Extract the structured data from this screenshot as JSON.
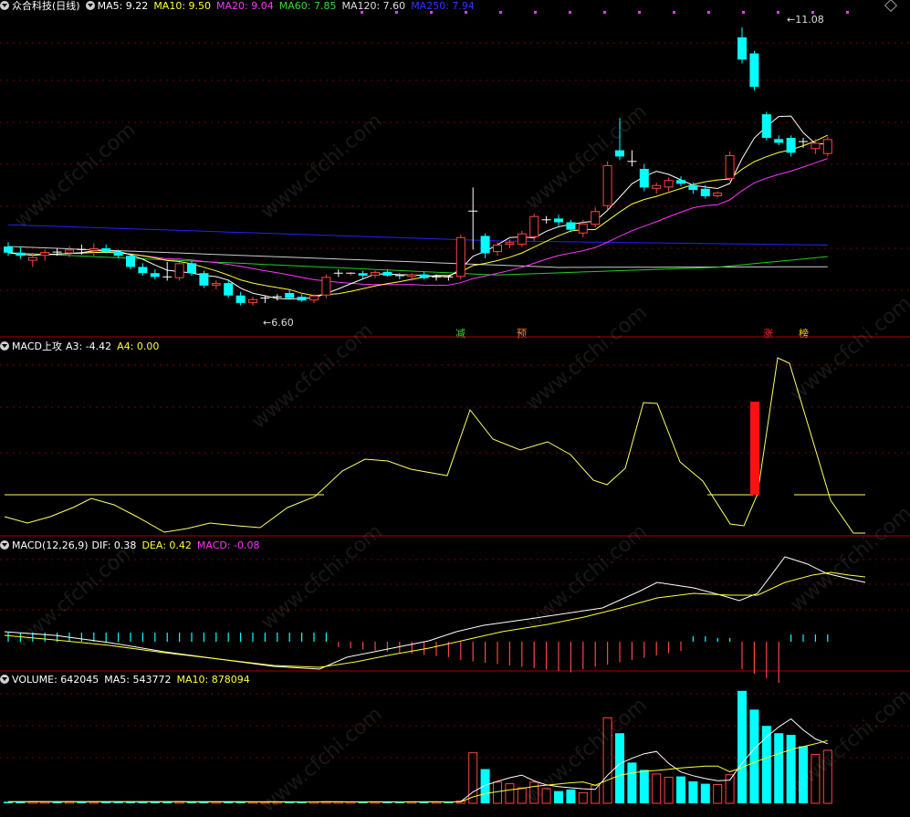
{
  "stock": {
    "title": "众合科技(日线)"
  },
  "panels": {
    "price": {
      "ma": [
        {
          "label": "MA5: 9.22",
          "color": "#ffffff"
        },
        {
          "label": "MA10: 9.50",
          "color": "#ffff33"
        },
        {
          "label": "MA20: 9.04",
          "color": "#ff33ff"
        },
        {
          "label": "MA60: 7.85",
          "color": "#33dd33"
        },
        {
          "label": "MA120: 7.60",
          "color": "#dddddd"
        },
        {
          "label": "MA250: 7.94",
          "color": "#3333ff"
        }
      ],
      "high_label": "11.08",
      "low_label": "6.60",
      "signal_tags": [
        {
          "text": "减",
          "color": "#33dd33"
        },
        {
          "text": "预",
          "color": "#ff8833"
        },
        {
          "text": "涨",
          "color": "#ff3333"
        },
        {
          "text": "榜",
          "color": "#ffcc00"
        }
      ]
    },
    "macd_attack": {
      "name": "MACD上攻",
      "a3": "A3: -4.42",
      "a4": "A4: 0.00"
    },
    "macd": {
      "name": "MACD(12,26,9)",
      "dif": "DIF: 0.38",
      "dea": "DEA: 0.42",
      "macd": "MACD: -0.08"
    },
    "volume": {
      "name": "VOLUME: 642045",
      "ma5": "MA5: 543772",
      "ma10": "MA10: 878094"
    }
  },
  "watermark": "www.cfchi.com",
  "colors": {
    "up": "#ff4444",
    "down": "#00ffff",
    "grid": "#7a0000",
    "bg": "#000000"
  },
  "chart_data": {
    "type": "candlestick",
    "price_axis_range": [
      6.3,
      11.3
    ],
    "candles": [
      {
        "o": 7.55,
        "h": 7.62,
        "l": 7.4,
        "c": 7.45
      },
      {
        "o": 7.45,
        "h": 7.55,
        "l": 7.35,
        "c": 7.4
      },
      {
        "o": 7.32,
        "h": 7.45,
        "l": 7.22,
        "c": 7.38
      },
      {
        "o": 7.4,
        "h": 7.5,
        "l": 7.32,
        "c": 7.46
      },
      {
        "o": 7.46,
        "h": 7.52,
        "l": 7.4,
        "c": 7.44
      },
      {
        "o": 7.44,
        "h": 7.56,
        "l": 7.38,
        "c": 7.5
      },
      {
        "o": 7.5,
        "h": 7.58,
        "l": 7.42,
        "c": 7.48
      },
      {
        "o": 7.48,
        "h": 7.6,
        "l": 7.4,
        "c": 7.52
      },
      {
        "o": 7.52,
        "h": 7.58,
        "l": 7.44,
        "c": 7.46
      },
      {
        "o": 7.46,
        "h": 7.5,
        "l": 7.36,
        "c": 7.4
      },
      {
        "o": 7.4,
        "h": 7.42,
        "l": 7.18,
        "c": 7.22
      },
      {
        "o": 7.22,
        "h": 7.28,
        "l": 7.08,
        "c": 7.12
      },
      {
        "o": 7.12,
        "h": 7.18,
        "l": 7.02,
        "c": 7.06
      },
      {
        "o": 7.06,
        "h": 7.3,
        "l": 7.0,
        "c": 7.04
      },
      {
        "o": 7.04,
        "h": 7.3,
        "l": 7.0,
        "c": 7.28
      },
      {
        "o": 7.28,
        "h": 7.32,
        "l": 7.08,
        "c": 7.12
      },
      {
        "o": 7.12,
        "h": 7.16,
        "l": 6.88,
        "c": 6.92
      },
      {
        "o": 6.92,
        "h": 7.0,
        "l": 6.86,
        "c": 6.96
      },
      {
        "o": 6.96,
        "h": 7.02,
        "l": 6.72,
        "c": 6.76
      },
      {
        "o": 6.76,
        "h": 6.82,
        "l": 6.6,
        "c": 6.64
      },
      {
        "o": 6.64,
        "h": 6.74,
        "l": 6.6,
        "c": 6.7
      },
      {
        "o": 6.7,
        "h": 6.76,
        "l": 6.64,
        "c": 6.72
      },
      {
        "o": 6.74,
        "h": 6.78,
        "l": 6.68,
        "c": 6.74
      },
      {
        "o": 6.8,
        "h": 6.86,
        "l": 6.7,
        "c": 6.72
      },
      {
        "o": 6.74,
        "h": 6.78,
        "l": 6.66,
        "c": 6.68
      },
      {
        "o": 6.68,
        "h": 6.78,
        "l": 6.64,
        "c": 6.76
      },
      {
        "o": 6.76,
        "h": 7.1,
        "l": 6.72,
        "c": 7.06
      },
      {
        "o": 7.12,
        "h": 7.18,
        "l": 7.06,
        "c": 7.12
      },
      {
        "o": 7.1,
        "h": 7.14,
        "l": 7.08,
        "c": 7.12
      },
      {
        "o": 7.12,
        "h": 7.16,
        "l": 7.04,
        "c": 7.08
      },
      {
        "o": 7.08,
        "h": 7.16,
        "l": 7.04,
        "c": 7.14
      },
      {
        "o": 7.14,
        "h": 7.18,
        "l": 7.06,
        "c": 7.08
      },
      {
        "o": 7.08,
        "h": 7.12,
        "l": 7.02,
        "c": 7.06
      },
      {
        "o": 7.06,
        "h": 7.12,
        "l": 7.0,
        "c": 7.1
      },
      {
        "o": 7.1,
        "h": 7.14,
        "l": 7.02,
        "c": 7.04
      },
      {
        "o": 7.04,
        "h": 7.1,
        "l": 7.0,
        "c": 7.06
      },
      {
        "o": 7.06,
        "h": 7.08,
        "l": 7.0,
        "c": 7.04
      },
      {
        "o": 7.06,
        "h": 7.74,
        "l": 7.02,
        "c": 7.7
      },
      {
        "o": 8.1,
        "h": 8.5,
        "l": 7.5,
        "c": 8.12
      },
      {
        "o": 7.72,
        "h": 7.76,
        "l": 7.36,
        "c": 7.44
      },
      {
        "o": 7.46,
        "h": 7.62,
        "l": 7.4,
        "c": 7.58
      },
      {
        "o": 7.58,
        "h": 7.66,
        "l": 7.52,
        "c": 7.62
      },
      {
        "o": 7.58,
        "h": 7.8,
        "l": 7.54,
        "c": 7.76
      },
      {
        "o": 7.7,
        "h": 8.08,
        "l": 7.64,
        "c": 8.04
      },
      {
        "o": 7.98,
        "h": 8.04,
        "l": 7.92,
        "c": 7.98
      },
      {
        "o": 8.0,
        "h": 8.06,
        "l": 7.88,
        "c": 7.94
      },
      {
        "o": 7.94,
        "h": 7.98,
        "l": 7.78,
        "c": 7.82
      },
      {
        "o": 7.76,
        "h": 7.98,
        "l": 7.7,
        "c": 7.92
      },
      {
        "o": 7.9,
        "h": 8.18,
        "l": 7.86,
        "c": 8.12
      },
      {
        "o": 8.2,
        "h": 8.92,
        "l": 8.14,
        "c": 8.86
      },
      {
        "o": 9.1,
        "h": 9.62,
        "l": 8.94,
        "c": 9.0
      },
      {
        "o": 8.92,
        "h": 9.1,
        "l": 8.84,
        "c": 8.9
      },
      {
        "o": 8.8,
        "h": 8.88,
        "l": 8.44,
        "c": 8.5
      },
      {
        "o": 8.48,
        "h": 8.58,
        "l": 8.4,
        "c": 8.54
      },
      {
        "o": 8.5,
        "h": 8.66,
        "l": 8.44,
        "c": 8.62
      },
      {
        "o": 8.62,
        "h": 8.68,
        "l": 8.52,
        "c": 8.56
      },
      {
        "o": 8.54,
        "h": 8.58,
        "l": 8.4,
        "c": 8.46
      },
      {
        "o": 8.48,
        "h": 8.54,
        "l": 8.32,
        "c": 8.36
      },
      {
        "o": 8.36,
        "h": 8.44,
        "l": 8.34,
        "c": 8.42
      },
      {
        "o": 8.64,
        "h": 9.08,
        "l": 8.6,
        "c": 9.02
      },
      {
        "o": 10.92,
        "h": 11.08,
        "l": 10.5,
        "c": 10.56
      },
      {
        "o": 10.66,
        "h": 10.7,
        "l": 10.06,
        "c": 10.12
      },
      {
        "o": 9.68,
        "h": 9.72,
        "l": 9.26,
        "c": 9.3
      },
      {
        "o": 9.28,
        "h": 9.34,
        "l": 9.18,
        "c": 9.22
      },
      {
        "o": 9.3,
        "h": 9.34,
        "l": 9.0,
        "c": 9.06
      },
      {
        "o": 9.24,
        "h": 9.3,
        "l": 9.14,
        "c": 9.22
      },
      {
        "o": 9.12,
        "h": 9.28,
        "l": 9.04,
        "c": 9.22
      },
      {
        "o": 9.04,
        "h": 9.32,
        "l": 9.0,
        "c": 9.28
      }
    ],
    "volume_axis_max": 1400000,
    "volume": [
      20000,
      18000,
      22000,
      19000,
      21000,
      20000,
      18000,
      17000,
      19000,
      22000,
      20000,
      18000,
      17000,
      19000,
      21000,
      16000,
      18000,
      17000,
      20000,
      19000,
      16000,
      15000,
      17000,
      16000,
      18000,
      17000,
      20000,
      18000,
      17000,
      16000,
      18000,
      17000,
      16000,
      19000,
      18000,
      17000,
      16000,
      30000,
      620000,
      420000,
      260000,
      240000,
      190000,
      260000,
      180000,
      150000,
      170000,
      130000,
      220000,
      1050000,
      860000,
      500000,
      410000,
      360000,
      320000,
      330000,
      270000,
      240000,
      230000,
      350000,
      1380000,
      1150000,
      950000,
      860000,
      840000,
      700000,
      600000,
      650000
    ]
  }
}
